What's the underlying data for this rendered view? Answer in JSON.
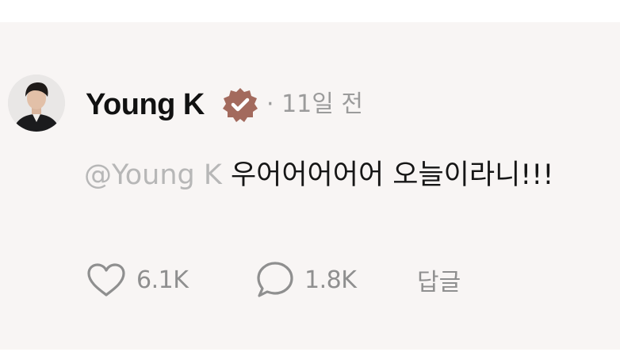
{
  "post": {
    "author": "Young K",
    "separator": "·",
    "time": "11일 전",
    "mention": "@Young K",
    "message": "우어어어어어 오늘이라니!!!"
  },
  "actions": {
    "likes": "6.1K",
    "comments": "1.8K",
    "reply_label": "답글"
  },
  "colors": {
    "verified_badge": "#a36a5d",
    "mention": "#b7b7b7",
    "secondary_text": "#9b9b9b"
  },
  "icons": [
    "verified-badge-icon",
    "heart-icon",
    "comment-icon"
  ]
}
